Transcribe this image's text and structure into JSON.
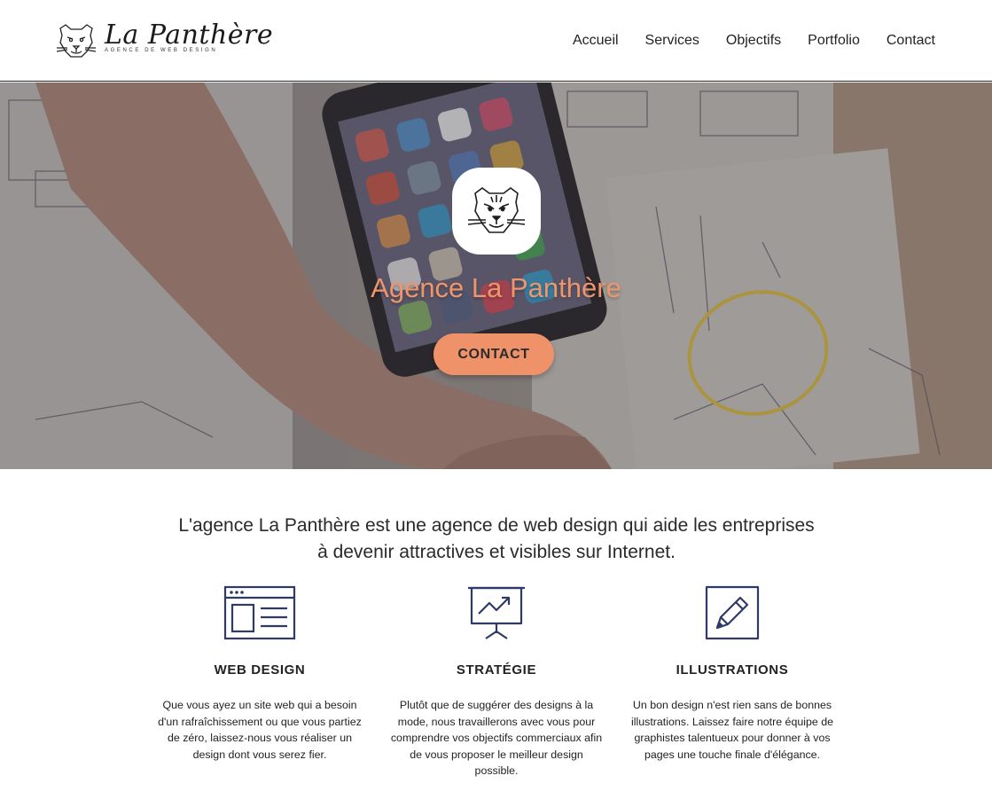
{
  "header": {
    "logo_name": "La Panthère",
    "logo_tagline": "AGENCE DE WEB DESIGN",
    "nav": [
      "Accueil",
      "Services",
      "Objectifs",
      "Portfolio",
      "Contact"
    ]
  },
  "hero": {
    "title": "Agence La Panthère",
    "button_label": "CONTACT"
  },
  "intro": {
    "text_line1": "L'agence La Panthère est une agence de web design qui aide les entreprises",
    "text_line2": "à devenir attractives et visibles sur Internet."
  },
  "features": [
    {
      "title": "WEB DESIGN",
      "icon": "browser-window-icon",
      "text": "Que vous ayez un site web qui a besoin d'un rafraîchissement ou que vous partiez de zéro, laissez-nous vous réaliser un design dont vous serez fier."
    },
    {
      "title": "STRATÉGIE",
      "icon": "presentation-chart-icon",
      "text": "Plutôt que de suggérer des designs à la mode, nous travaillerons avec vous pour comprendre vos objectifs commerciaux afin de vous proposer le meilleur design possible."
    },
    {
      "title": "ILLUSTRATIONS",
      "icon": "pencil-icon",
      "text": "Un bon design n'est rien sans de bonnes illustrations. Laissez faire notre équipe de graphistes talentueux pour donner à vos pages une touche finale d'élégance."
    }
  ],
  "colors": {
    "accent": "#ef9169",
    "hero_title": "#f0956a",
    "icon_stroke": "#2f3a66"
  }
}
